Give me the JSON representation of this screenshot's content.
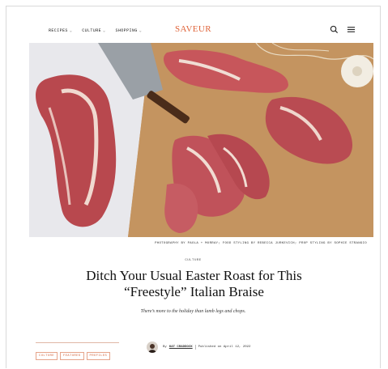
{
  "header": {
    "nav": [
      {
        "label": "RECIPES"
      },
      {
        "label": "CULTURE"
      },
      {
        "label": "SHOPPING"
      }
    ],
    "logo": "SAVEUR",
    "accent_color": "#e0643a"
  },
  "hero": {
    "credit": "PHOTOGRAPHY BY PAOLA + MURRAY; FOOD STYLING BY REBECCA JURKEVICH; PROP STYLING BY SOPHIE STRANGIO"
  },
  "article": {
    "kicker": "CULTURE",
    "headline": "Ditch Your Usual Easter Roast for This “Freestyle” Italian Braise",
    "dek": "There’s more to the holiday than lamb legs and chops."
  },
  "tags": [
    "CULTURE",
    "FEATURES",
    "PROFILES"
  ],
  "byline": {
    "by": "By",
    "author": "KAT CRADDOCK",
    "published": "Published on April 12, 2022"
  }
}
